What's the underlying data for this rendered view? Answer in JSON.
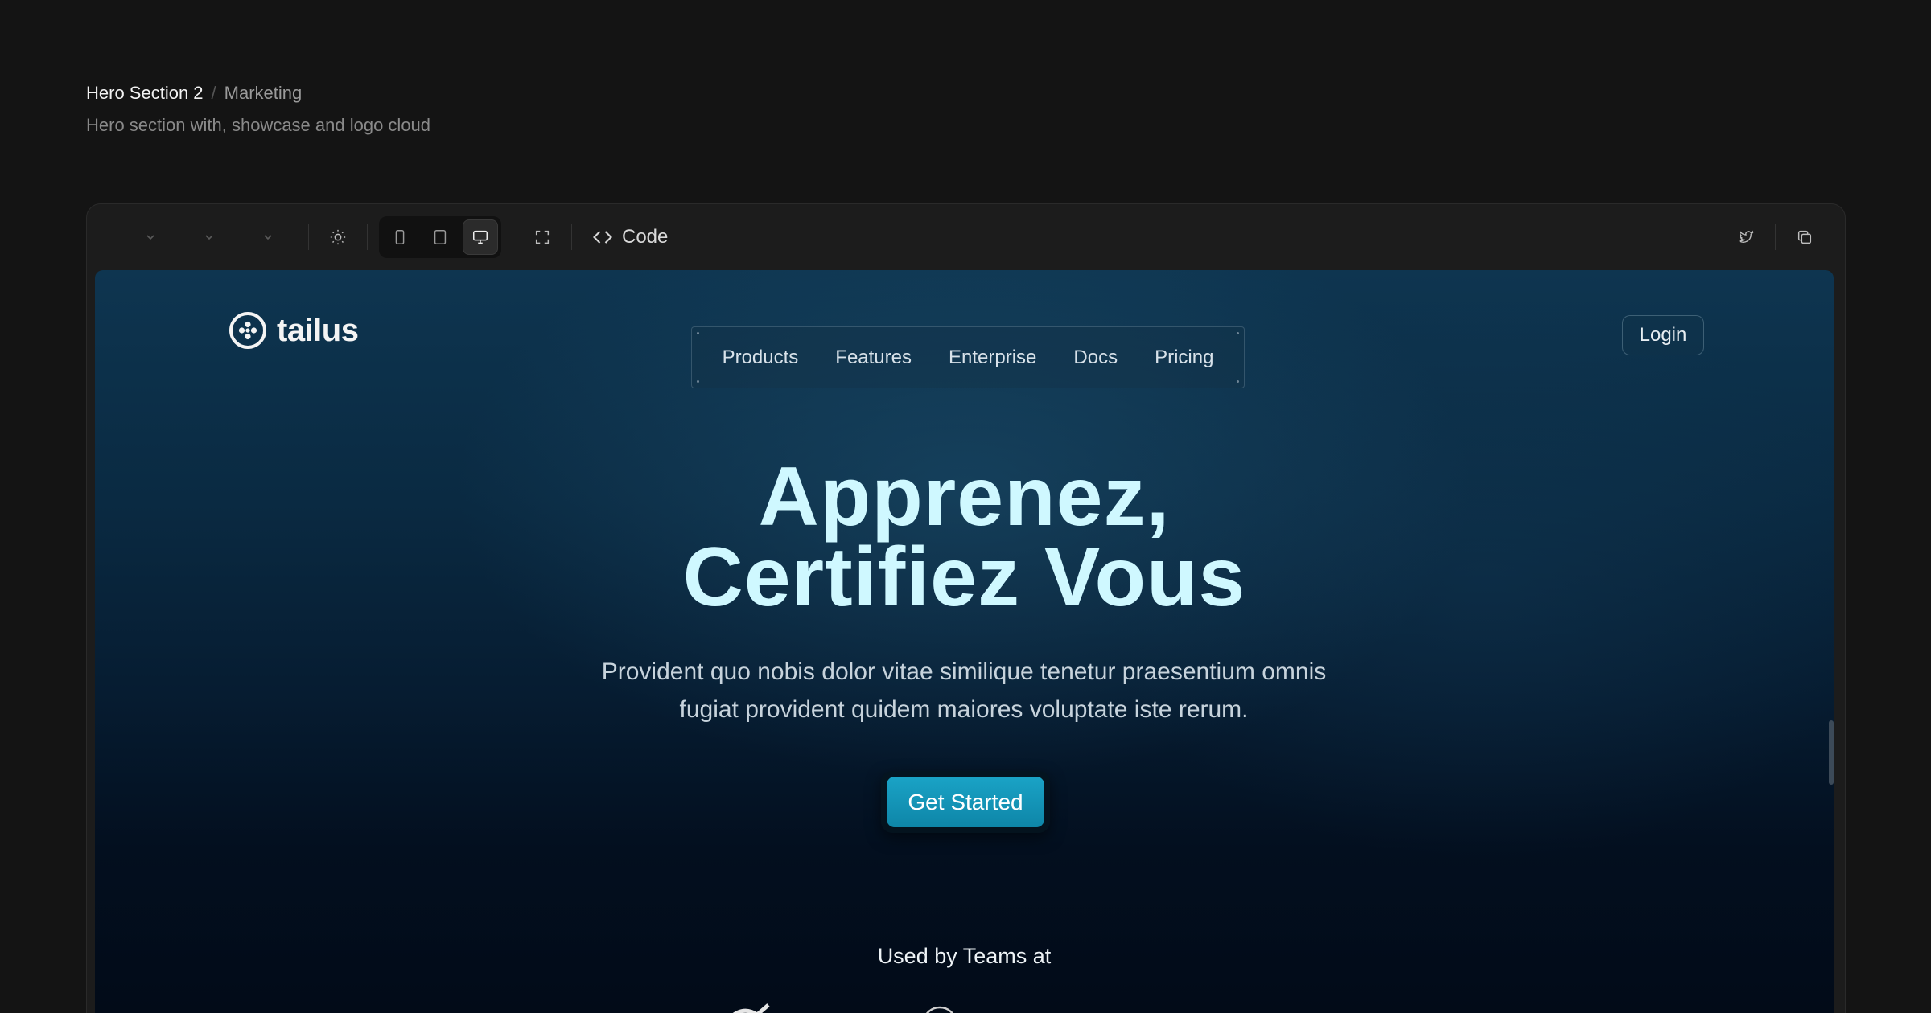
{
  "page": {
    "title": "Hero Section 2",
    "separator": "/",
    "category": "Marketing",
    "description": "Hero section with, showcase and logo cloud"
  },
  "toolbar": {
    "code_label": "Code"
  },
  "site": {
    "brand": "tailus",
    "nav": [
      "Products",
      "Features",
      "Enterprise",
      "Docs",
      "Pricing"
    ],
    "login": "Login",
    "hero": {
      "title_line1": "Apprenez,",
      "title_line2": "Certifiez Vous",
      "subtitle_line1": "Provident quo nobis dolor vitae similique tenetur praesentium omnis",
      "subtitle_line2": "fugiat provident quidem maiores voluptate iste rerum.",
      "cta": "Get Started"
    },
    "logo_cloud_label": "Used by Teams at"
  },
  "colors": {
    "hero_title": "#cff8ff",
    "cta": "#1aa3c6",
    "page_bg": "#141414"
  }
}
